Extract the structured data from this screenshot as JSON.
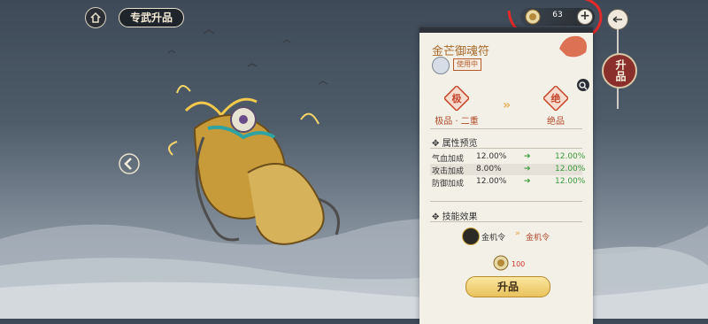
{
  "header": {
    "title": "专武升品",
    "currency_amount": "63",
    "plus_label": "+"
  },
  "side_tag": {
    "label": "升品"
  },
  "panel": {
    "item_name": "金芒御魂符",
    "status_badge": "使用中",
    "grade_from": {
      "glyph": "极",
      "label": "极品 · 二重"
    },
    "grade_to": {
      "glyph": "绝",
      "label": "绝品"
    },
    "attributes_title": "属性预览",
    "attributes": [
      {
        "name": "气血加成",
        "current": "12.00%",
        "next": "12.00%"
      },
      {
        "name": "攻击加成",
        "current": "8.00%",
        "next": "12.00%"
      },
      {
        "name": "防御加成",
        "current": "12.00%",
        "next": "12.00%"
      }
    ],
    "skill_title": "技能效果",
    "skill_from": "金机令",
    "skill_to": "金机令",
    "cost_amount": "100",
    "upgrade_button": "升品"
  },
  "colors": {
    "accent_red": "#b24a2a",
    "gain_green": "#3a9a3a",
    "gold_button": "#e9c25c"
  },
  "icons": [
    "home-icon",
    "coin-icon",
    "plus-icon",
    "back-icon",
    "left-arrow-icon",
    "magnify-icon",
    "avatar-icon",
    "stamp-icon",
    "skill-icon",
    "cost-icon"
  ]
}
